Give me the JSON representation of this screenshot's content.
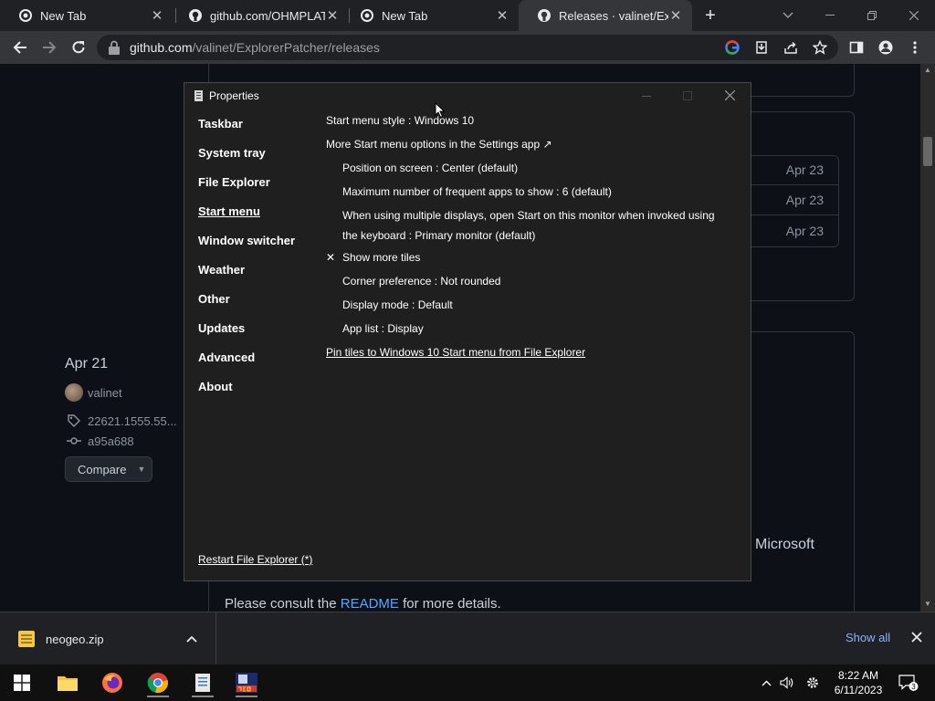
{
  "browser": {
    "tabs": [
      {
        "title": "New Tab",
        "icon": "chrome-icon",
        "active": false
      },
      {
        "title": "github.com/OHMPLATF",
        "icon": "github-icon",
        "active": false
      },
      {
        "title": "New Tab",
        "icon": "chrome-icon",
        "active": false
      },
      {
        "title": "Releases · valinet/Explo",
        "icon": "github-icon",
        "active": true
      }
    ],
    "url_host": "github.com",
    "url_path": "/valinet/ExplorerPatcher/releases"
  },
  "page": {
    "asset_dates": [
      "Apr 23",
      "Apr 23",
      "Apr 23"
    ],
    "release_date": "Apr 21",
    "author": "valinet",
    "tag": "22621.1555.55...",
    "commit": "a95a688",
    "compare_label": "Compare",
    "microsoft_text": "Microsoft",
    "readme_prefix": "Please consult the ",
    "readme_link": "README",
    "readme_suffix": " for more details."
  },
  "properties": {
    "window_title": "Properties",
    "nav": [
      {
        "label": "Taskbar",
        "selected": false
      },
      {
        "label": "System tray",
        "selected": false
      },
      {
        "label": "File Explorer",
        "selected": false
      },
      {
        "label": "Start menu",
        "selected": true
      },
      {
        "label": "Window switcher",
        "selected": false
      },
      {
        "label": "Weather",
        "selected": false
      },
      {
        "label": "Other",
        "selected": false
      },
      {
        "label": "Updates",
        "selected": false
      },
      {
        "label": "Advanced",
        "selected": false
      },
      {
        "label": "About",
        "selected": false
      }
    ],
    "options": {
      "start_menu_style": "Start menu style : Windows 10",
      "more_options": "More Start menu options in the Settings app ↗",
      "position": "Position on screen : Center (default)",
      "max_frequent": "Maximum number of frequent apps to show : 6 (default)",
      "multi_display_1": "When using multiple displays, open Start on this monitor when invoked using",
      "multi_display_2": "the keyboard : Primary monitor (default)",
      "show_more_tiles_check": "✕",
      "show_more_tiles": "Show more tiles",
      "corner_pref": "Corner preference : Not rounded",
      "display_mode": "Display mode : Default",
      "app_list": "App list : Display",
      "pin_tiles": "Pin tiles to Windows 10 Start menu from File Explorer"
    },
    "restart_link": "Restart File Explorer (*)"
  },
  "downloads": {
    "file": "neogeo.zip",
    "show_all": "Show all"
  },
  "taskbar": {
    "time": "8:22 AM",
    "date": "6/11/2023",
    "notifications": "3"
  }
}
